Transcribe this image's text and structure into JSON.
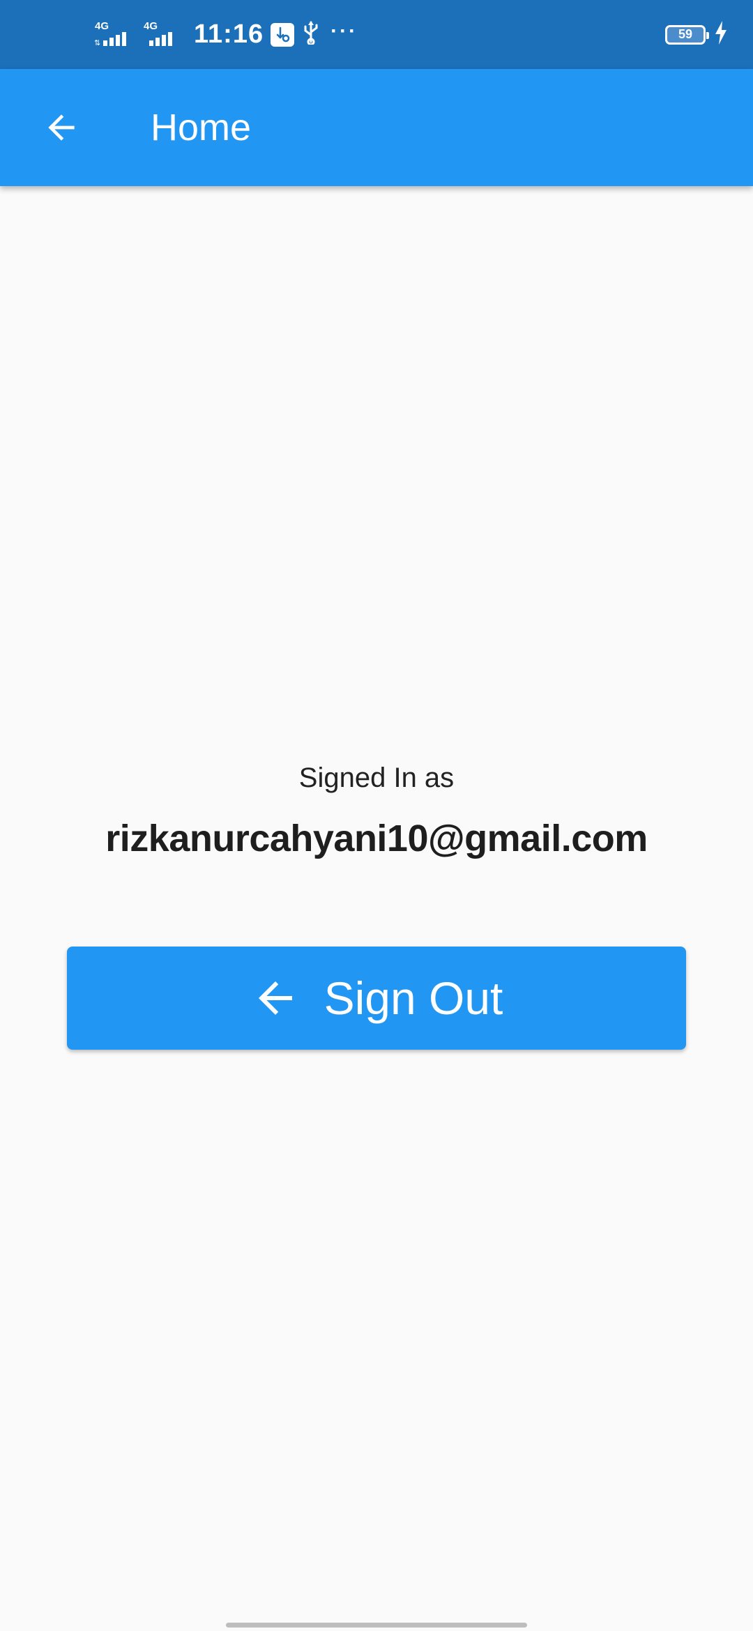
{
  "status_bar": {
    "network_1": "4G",
    "network_2": "4G",
    "time": "11:16",
    "battery_level": "59",
    "overflow_dots": "···",
    "icons": [
      "signal-icon",
      "signal-icon",
      "usb-settings-icon",
      "usb-icon",
      "battery-icon",
      "charging-icon"
    ]
  },
  "app_bar": {
    "title": "Home",
    "back_icon": "arrow-back-icon"
  },
  "main": {
    "signed_in_label": "Signed In as",
    "email": "rizkanurcahyani10@gmail.com",
    "sign_out_label": "Sign Out",
    "sign_out_icon": "arrow-back-icon"
  },
  "colors": {
    "status_bar": "#1c70b9",
    "app_bar": "#2196f3",
    "button": "#2196f3",
    "background": "#fafafa"
  }
}
